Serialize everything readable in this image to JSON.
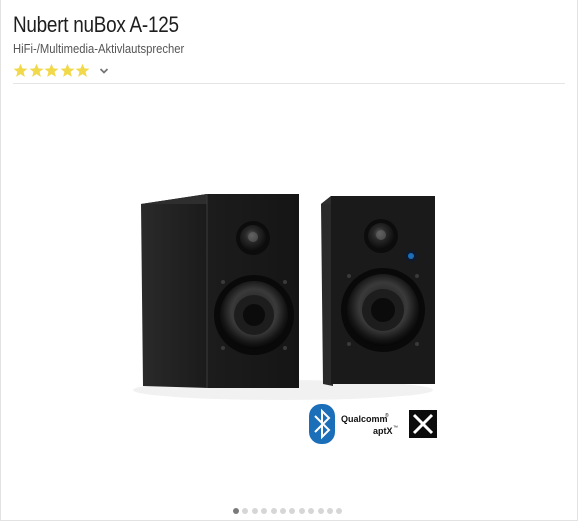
{
  "product": {
    "title": "Nubert nuBox A-125",
    "subtitle": "HiFi-/Multimedia-Aktivlautsprecher",
    "rating": {
      "stars": 5,
      "max": 5,
      "star_color": "#f2d84b"
    },
    "rating_toggle_icon": "chevron-down-icon"
  },
  "image": {
    "badges": {
      "bluetooth_icon": "bluetooth-icon",
      "qualcomm_text": "Qualcomm",
      "aptx_text": "aptX",
      "registered_mark": "®",
      "tm_mark": "™",
      "x_logo": "x-logo"
    },
    "speaker_color": "#1b1b1b",
    "bluetooth_color": "#1a6fb8"
  },
  "carousel": {
    "slide_count": 12,
    "active_index": 0,
    "active_color": "#7a7a7a",
    "inactive_color": "#d6d6d6"
  }
}
